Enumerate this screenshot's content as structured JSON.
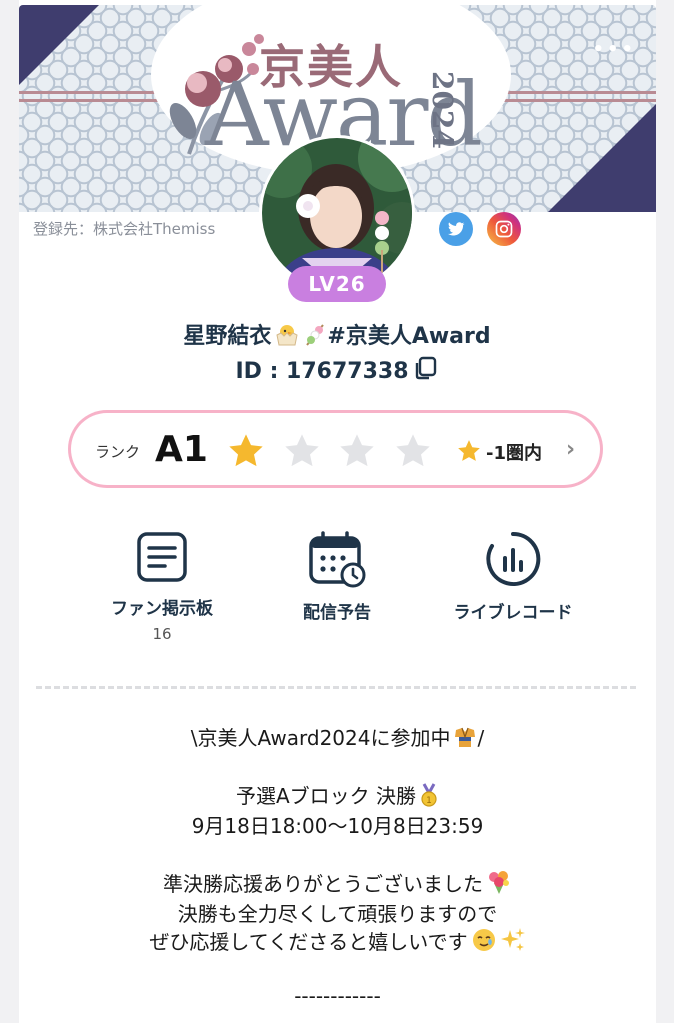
{
  "banner": {
    "title_jp": "京美人",
    "title_en": "Award",
    "year": "2024",
    "menu_dots": "•••"
  },
  "profile": {
    "affiliation": "登録先：株式会社Themiss",
    "level": "LV26",
    "name": "星野結衣",
    "hashtag": "#京美人Award",
    "id_text": "ID : 17677338"
  },
  "rank": {
    "label": "ランク",
    "value": "A1",
    "stars_filled": 1,
    "stars_total": 5,
    "next_text": "-1圏内"
  },
  "menu": [
    {
      "label": "ファン掲示板",
      "count": "16",
      "icon": "bulletin-board-icon"
    },
    {
      "label": "配信予告",
      "icon": "calendar-clock-icon"
    },
    {
      "label": "ライブレコード",
      "icon": "live-record-icon"
    }
  ],
  "description": {
    "line1": "\\京美人Award2024に参加中",
    "line1_tail": "/",
    "line2": "予選Aブロック 決勝",
    "line3": "9月18日18:00〜10月8日23:59",
    "line4": "準決勝応援ありがとうございました",
    "line5": "決勝も全力尽くして頑張りますので",
    "line6": "ぜひ応援してくださると嬉しいです",
    "line7": "------------"
  },
  "colors": {
    "accent_pink": "#f7b2c8",
    "level_purple": "#c97fe0",
    "star_gold": "#f5b82e",
    "navy_text": "#1f3448",
    "banner_navy": "#3f3d6e"
  }
}
